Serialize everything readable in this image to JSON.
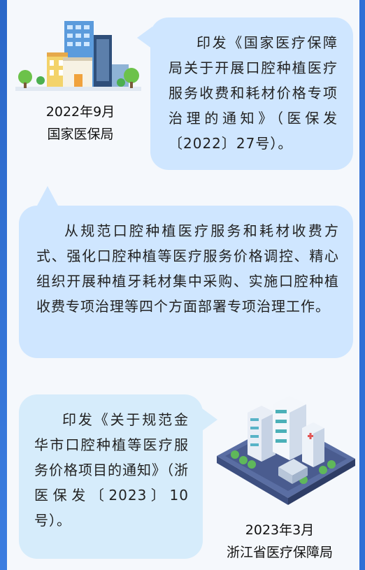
{
  "blocks": [
    {
      "text": "印发《国家医疗保障局关于开展口腔种植医疗服务收费和耗材价格专项治理的通知》（医保发〔2022〕27号）。",
      "date": "2022年9月",
      "org": "国家医保局"
    },
    {
      "text": "从规范口腔种植医疗服务和耗材收费方式、强化口腔种植等医疗服务价格调控、精心组织开展种植牙耗材集中采购、实施口腔种植收费专项治理等四个方面部署专项治理工作。"
    },
    {
      "text": "印发《关于规范金华市口腔种植等医疗服务价格项目的通知》（浙医保发〔2023〕10号）。",
      "date": "2023年3月",
      "org": "浙江省医疗保障局"
    }
  ],
  "icons": [
    "city-buildings-icon",
    "hospital-isometric-icon"
  ],
  "colors": {
    "bubble": "#cfe6ff",
    "bubble_alt": "#d6ecfb",
    "edge": "#2f6fd6",
    "background": "#f5f8fc"
  }
}
